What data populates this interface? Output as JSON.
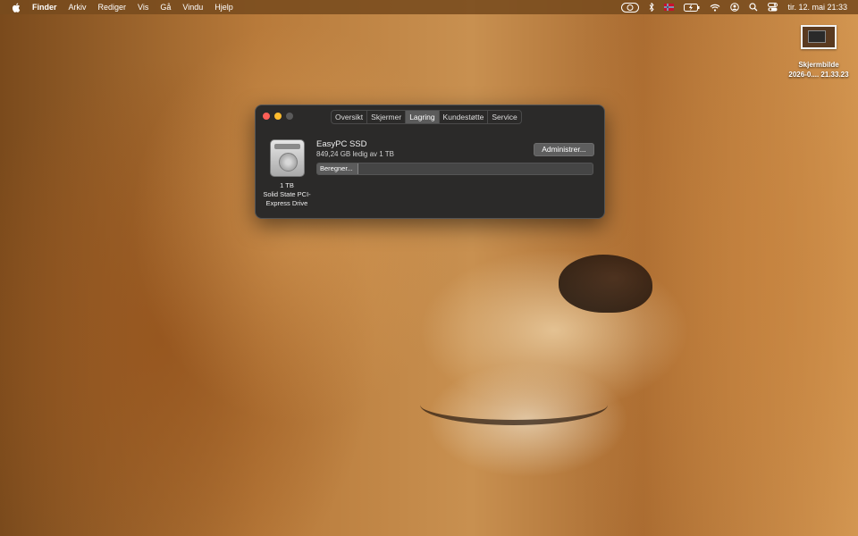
{
  "menubar": {
    "apple_icon": "apple-logo-icon",
    "items": [
      "Finder",
      "Arkiv",
      "Rediger",
      "Vis",
      "Gå",
      "Vindu",
      "Hjelp"
    ],
    "status_icons": [
      "browser-network-icon",
      "bluetooth-icon",
      "keyboard-flag-icon",
      "battery-icon",
      "wifi-icon",
      "user-icon",
      "search-icon",
      "control-center-icon"
    ],
    "clock": "tir. 12. mai  21:33"
  },
  "desktop": {
    "screenshot_label_line1": "Skjermbilde",
    "screenshot_label_line2": "2026-0.... 21.33.23"
  },
  "window": {
    "tabs": [
      {
        "label": "Oversikt",
        "active": false
      },
      {
        "label": "Skjermer",
        "active": false
      },
      {
        "label": "Lagring",
        "active": true
      },
      {
        "label": "Kundestøtte",
        "active": false
      },
      {
        "label": "Service",
        "active": false
      }
    ],
    "drive": {
      "icon": "hard-drive-icon",
      "caption_size": "1 TB",
      "caption_type": "Solid State PCI-Express Drive",
      "name": "EasyPC SSD",
      "free": "849,24 GB ledig av 1 TB",
      "manage_button": "Administrer...",
      "bar_label": "Beregner..."
    }
  }
}
